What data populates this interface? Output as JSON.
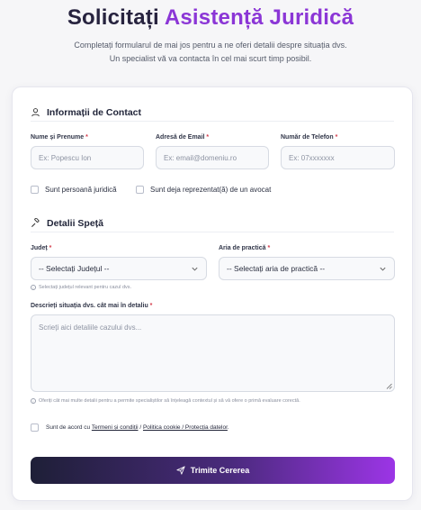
{
  "header": {
    "title_part1": "Solicitați",
    "title_part2": "Asistență Juridică",
    "subtitle_line1": "Completați formularul de mai jos pentru a ne oferi detalii despre situația dvs.",
    "subtitle_line2": "Un specialist vă va contacta în cel mai scurt timp posibil."
  },
  "contact": {
    "heading": "Informații de Contact",
    "icon": "user-icon",
    "name_label": "Nume și Prenume",
    "name_placeholder": "Ex: Popescu Ion",
    "email_label": "Adresă de Email",
    "email_placeholder": "Ex: email@domeniu.ro",
    "phone_label": "Număr de Telefon",
    "phone_placeholder": "Ex: 07xxxxxxx",
    "required_mark": "*",
    "checkbox_legal": "Sunt persoană juridică",
    "checkbox_lawyer": "Sunt deja reprezentat(ă) de un avocat"
  },
  "case": {
    "heading": "Detalii Speță",
    "icon": "gavel-icon",
    "county_label": "Județ",
    "county_value": "-- Selectați Județul --",
    "county_hint": "Selectați județul relevant pentru cazul dvs.",
    "practice_label": "Aria de practică",
    "practice_value": "-- Selectați aria de practică --",
    "description_label": "Descrieți situația dvs. cât mai în detaliu",
    "description_placeholder": "Scrieți aici detaliile cazului dvs...",
    "description_hint": "Oferiți cât mai multe detalii pentru a permite specialiștilor să înțeleagă contextul și să vă ofere o primă evaluare corectă."
  },
  "consent": {
    "prefix": "Sunt de acord cu",
    "terms": "Termeni și condiții",
    "sep1": "/",
    "cookie": "Politica cookie / Protecția datelor",
    "suffix": "."
  },
  "submit": {
    "label": "Trimite Cererea",
    "icon": "send-icon"
  },
  "colors": {
    "accent": "#8b36d6",
    "title_dark": "#27233f",
    "required": "#d43b4b"
  }
}
